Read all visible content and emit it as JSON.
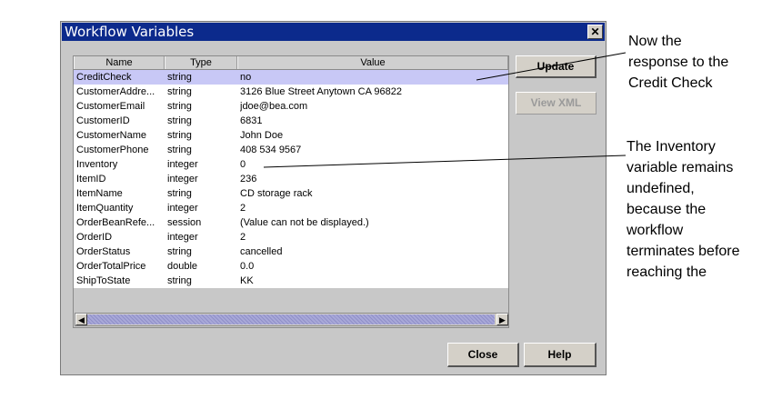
{
  "dialog": {
    "title": "Workflow Variables",
    "close_glyph": "✕"
  },
  "table": {
    "headers": [
      "Name",
      "Type",
      "Value"
    ],
    "selected_row_index": 0,
    "rows": [
      {
        "name": "CreditCheck",
        "type": "string",
        "value": "no"
      },
      {
        "name": "CustomerAddre...",
        "type": "string",
        "value": "3126 Blue Street Anytown CA 96822"
      },
      {
        "name": "CustomerEmail",
        "type": "string",
        "value": "jdoe@bea.com"
      },
      {
        "name": "CustomerID",
        "type": "string",
        "value": "6831"
      },
      {
        "name": "CustomerName",
        "type": "string",
        "value": "John Doe"
      },
      {
        "name": "CustomerPhone",
        "type": "string",
        "value": "408 534 9567"
      },
      {
        "name": "Inventory",
        "type": "integer",
        "value": "0"
      },
      {
        "name": "ItemID",
        "type": "integer",
        "value": "236"
      },
      {
        "name": "ItemName",
        "type": "string",
        "value": "CD storage rack"
      },
      {
        "name": "ItemQuantity",
        "type": "integer",
        "value": "2"
      },
      {
        "name": "OrderBeanRefe...",
        "type": "session",
        "value": "(Value can not be displayed.)"
      },
      {
        "name": "OrderID",
        "type": "integer",
        "value": "2"
      },
      {
        "name": "OrderStatus",
        "type": "string",
        "value": "cancelled"
      },
      {
        "name": "OrderTotalPrice",
        "type": "double",
        "value": "0.0"
      },
      {
        "name": "ShipToState",
        "type": "string",
        "value": "KK"
      }
    ]
  },
  "scrollbar": {
    "left_arrow": "◀",
    "right_arrow": "▶"
  },
  "buttons": {
    "update": "Update",
    "view_xml": "View XML",
    "close": "Close",
    "help": "Help"
  },
  "callouts": {
    "credit_check": [
      "Now the",
      "response to the",
      "Credit Check"
    ],
    "inventory": [
      "The Inventory",
      "variable remains",
      "undefined,",
      "because the",
      "workflow",
      "terminates before",
      "reaching the"
    ]
  },
  "colors": {
    "titlebar": "#0c2a8c",
    "selected_row": "#c8c8f6",
    "dialog_bg": "#c8c8c8"
  }
}
